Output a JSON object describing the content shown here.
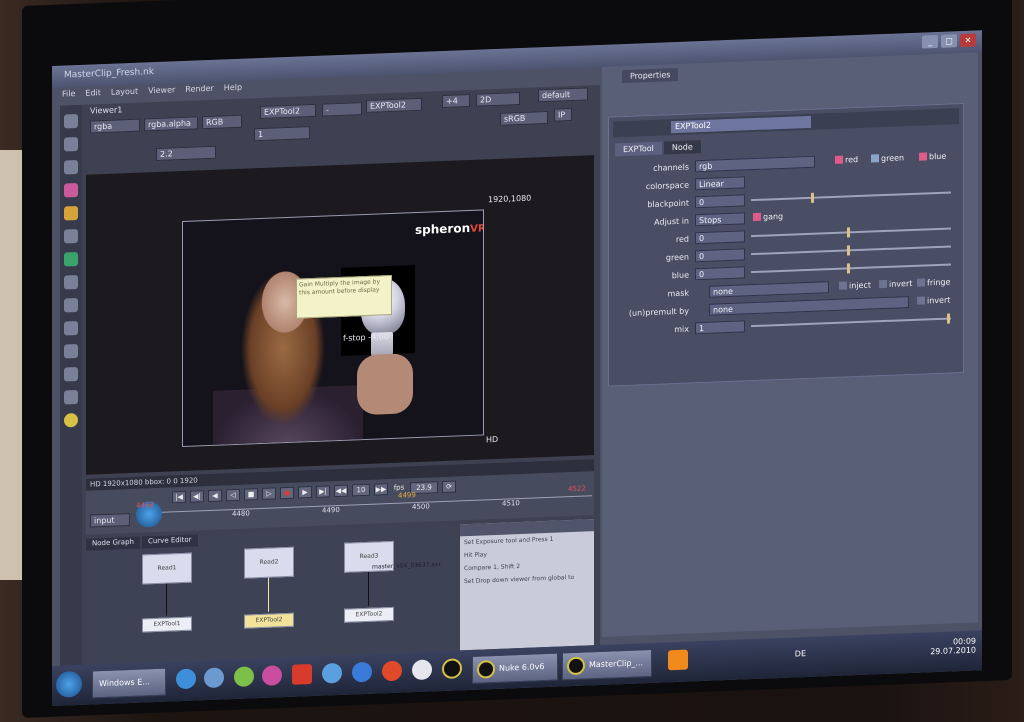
{
  "window": {
    "title": "MasterClip_Fresh.nk"
  },
  "menu": [
    "File",
    "Edit",
    "Layout",
    "Viewer",
    "Render",
    "Help"
  ],
  "viewer": {
    "tab": "Viewer1",
    "channels": "rgba",
    "alpha": "rgba.alpha",
    "display": "RGB",
    "input_a": "EXPTool2",
    "input_b": "EXPTool2",
    "gain": "1",
    "frame_gain": "2.2",
    "exposure_offset": "+4",
    "mode": "2D",
    "lut": "default",
    "colorspace": "sRGB",
    "resolution_label": "1920,1080",
    "format_label": "HD",
    "info_bar": "HD 1920x1080  bbox: 0 0 1920",
    "stop_label": "f-stop -4.00",
    "logo": "spheronVR",
    "tooltip": "Gain Multiply the image by this amount before display"
  },
  "timeline": {
    "fps_label": "fps",
    "fps_value": "23.9",
    "step": "10",
    "input_label": "input",
    "ticks": [
      "4480",
      "4490",
      "4500",
      "4510",
      "4522"
    ],
    "current_frame": "4499",
    "start_frame": "4468"
  },
  "node_graph": {
    "tabs": [
      "Node Graph",
      "Curve Editor"
    ],
    "reads": [
      "Read1",
      "Read2",
      "Read3"
    ],
    "read3_file": "master_v04_03637.exr",
    "exp_nodes": [
      "EXPTool1",
      "EXPTool2",
      "EXPTool2"
    ]
  },
  "script_notes": [
    "Set Exposure tool and Press 1",
    "Hit Play",
    "Compare 1, Shift 2",
    "Set Drop down viewer from global to"
  ],
  "properties": {
    "pane_title": "Properties",
    "node_name": "EXPTool2",
    "tabs": [
      "EXPTool",
      "Node"
    ],
    "rows": [
      {
        "label": "channels",
        "value": "rgb"
      },
      {
        "label": "colorspace",
        "value": "Linear"
      },
      {
        "label": "blackpoint",
        "value": "0"
      },
      {
        "label": "Adjust in",
        "value": "Stops"
      },
      {
        "label": "red",
        "value": "0"
      },
      {
        "label": "green",
        "value": "0"
      },
      {
        "label": "blue",
        "value": "0"
      },
      {
        "label": "mask",
        "value": "none"
      },
      {
        "label": "(un)premult by",
        "value": "none"
      },
      {
        "label": "mix",
        "value": "1"
      }
    ],
    "checks": {
      "red": "red",
      "green": "green",
      "blue": "blue",
      "gang": "gang",
      "inject": "inject",
      "invert": "invert",
      "fringe": "fringe"
    }
  },
  "taskbar": {
    "buttons": [
      "Windows E...",
      "Nuke 6.0v6",
      "MasterClip_..."
    ],
    "lang": "DE",
    "time": "00:09",
    "date": "29.07.2010"
  }
}
